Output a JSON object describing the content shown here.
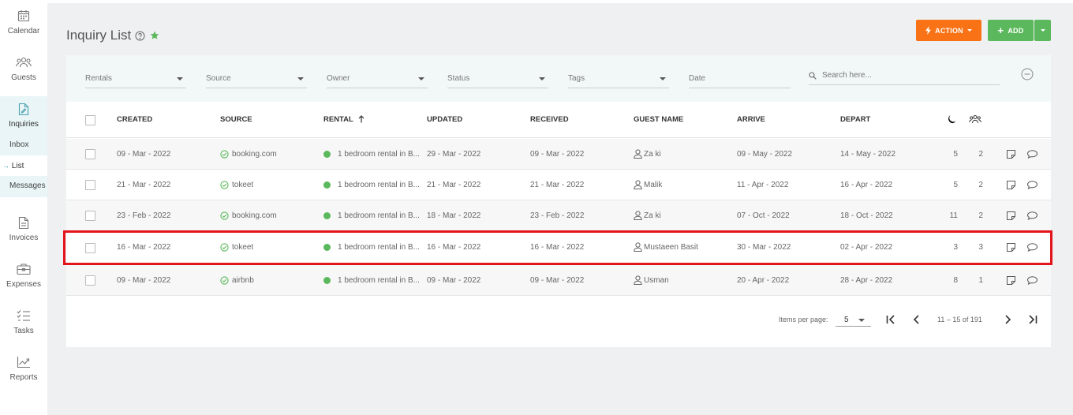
{
  "sidebar": {
    "items": [
      {
        "label": "Calendar",
        "icon": "calendar-icon"
      },
      {
        "label": "Guests",
        "icon": "guests-icon"
      },
      {
        "label": "Inquiries",
        "icon": "inquiries-icon"
      },
      {
        "label": "Invoices",
        "icon": "invoices-icon"
      },
      {
        "label": "Expenses",
        "icon": "expenses-icon"
      },
      {
        "label": "Tasks",
        "icon": "tasks-icon"
      },
      {
        "label": "Reports",
        "icon": "reports-icon"
      }
    ],
    "subitems": [
      "Inbox",
      "List",
      "Messages"
    ],
    "active_sub_arrow": "→"
  },
  "header": {
    "title": "Inquiry List",
    "action_label": "ACTION",
    "add_label": "ADD",
    "action_color": "#f97316",
    "add_color": "#5cb85c"
  },
  "filters": {
    "rentals": "Rentals",
    "source": "Source",
    "owner": "Owner",
    "status": "Status",
    "tags": "Tags",
    "date": "Date",
    "search_placeholder": "Search here..."
  },
  "table": {
    "headers": [
      "CREATED",
      "SOURCE",
      "RENTAL",
      "UPDATED",
      "RECEIVED",
      "GUEST NAME",
      "ARRIVE",
      "DEPART"
    ],
    "rows": [
      {
        "created": "09 - Mar - 2022",
        "source": "booking.com",
        "rental": "1 bedroom rental in B...",
        "updated": "29 - Mar - 2022",
        "received": "09 - Mar - 2022",
        "guest": "Za ki",
        "arrive": "09 - May - 2022",
        "depart": "14 - May - 2022",
        "nights": "5",
        "guests": "2"
      },
      {
        "created": "21 - Mar - 2022",
        "source": "tokeet",
        "rental": "1 bedroom rental in B...",
        "updated": "21 - Mar - 2022",
        "received": "21 - Mar - 2022",
        "guest": "Malik",
        "arrive": "11 - Apr - 2022",
        "depart": "16 - Apr - 2022",
        "nights": "5",
        "guests": "2"
      },
      {
        "created": "23 - Feb - 2022",
        "source": "booking.com",
        "rental": "1 bedroom rental in B...",
        "updated": "18 - Mar - 2022",
        "received": "23 - Feb - 2022",
        "guest": "Za ki",
        "arrive": "07 - Oct - 2022",
        "depart": "18 - Oct - 2022",
        "nights": "11",
        "guests": "2"
      },
      {
        "created": "16 - Mar - 2022",
        "source": "tokeet",
        "rental": "1 bedroom rental in B...",
        "updated": "16 - Mar - 2022",
        "received": "16 - Mar - 2022",
        "guest": "Mustaeen Basit",
        "arrive": "30 - Mar - 2022",
        "depart": "02 - Apr - 2022",
        "nights": "3",
        "guests": "3"
      },
      {
        "created": "09 - Mar - 2022",
        "source": "airbnb",
        "rental": "1 bedroom rental in B...",
        "updated": "09 - Mar - 2022",
        "received": "09 - Mar - 2022",
        "guest": "Usman",
        "arrive": "20 - Apr - 2022",
        "depart": "28 - Apr - 2022",
        "nights": "8",
        "guests": "1"
      }
    ]
  },
  "pagination": {
    "items_per_page_label": "Items per page:",
    "items_per_page": "5",
    "range": "11 – 15 of 191"
  },
  "colors": {
    "status_dot": "#5cb85c",
    "star": "#5cb85c",
    "highlight": "#e3141c"
  }
}
